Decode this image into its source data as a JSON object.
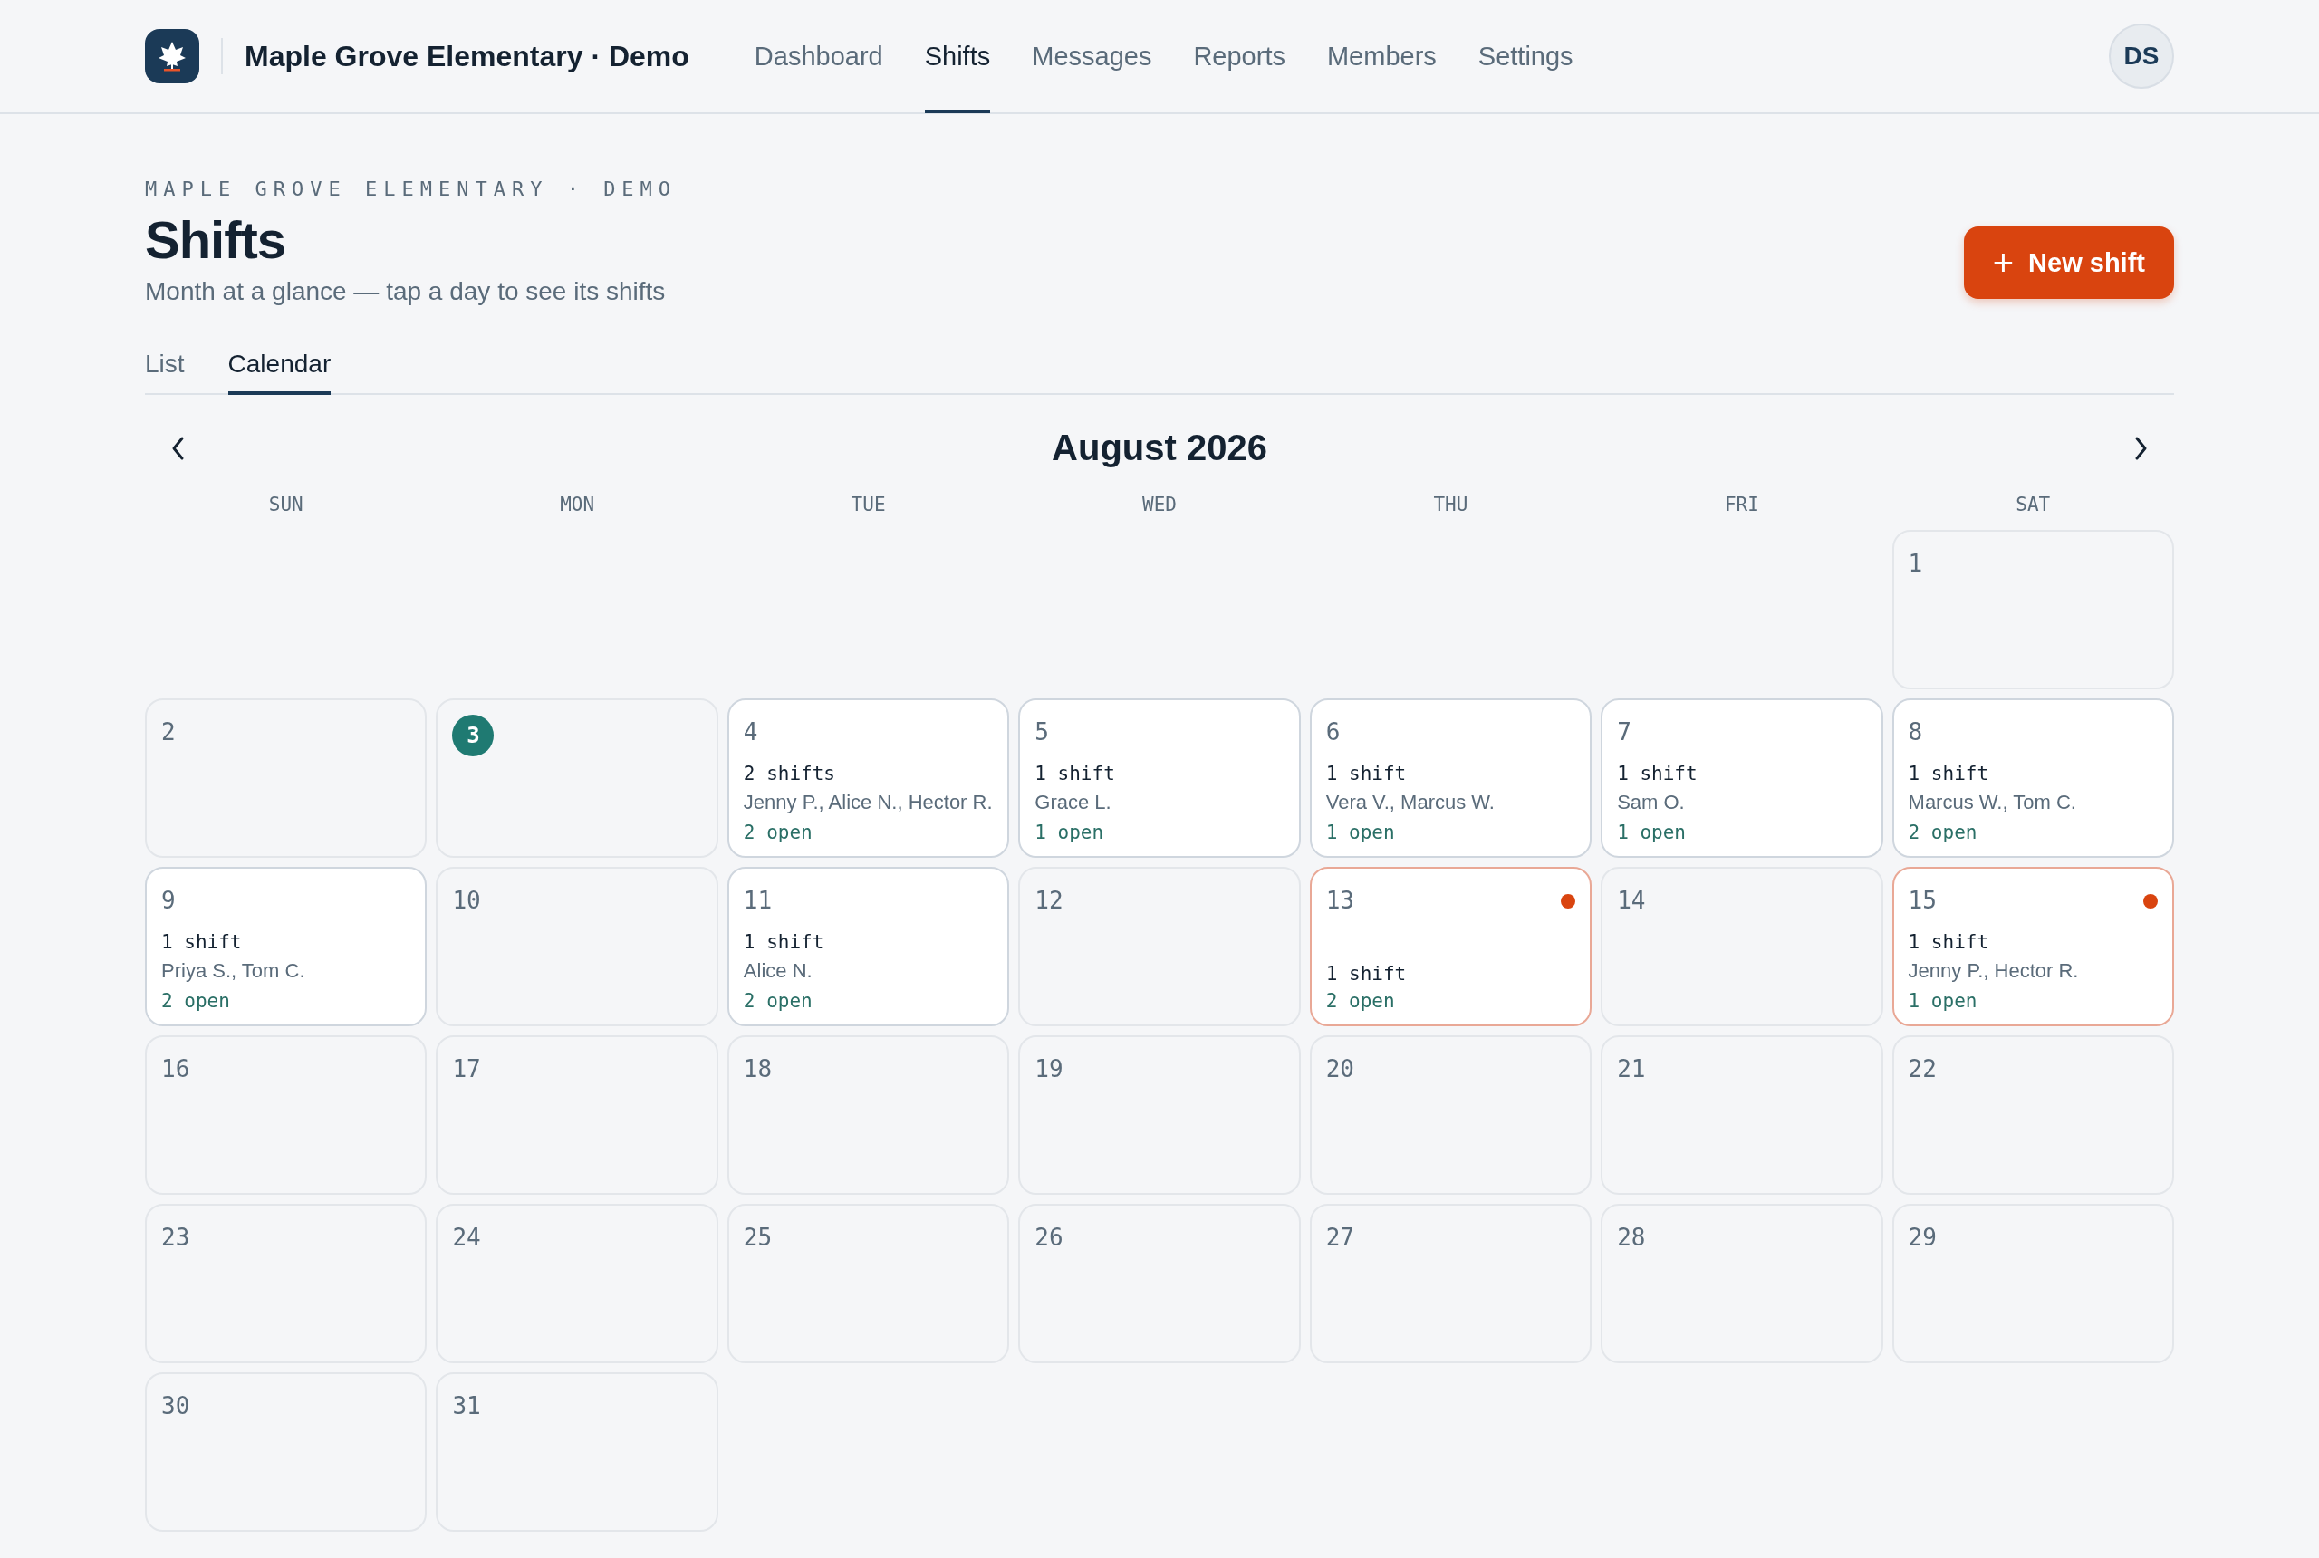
{
  "header": {
    "brand": "Maple Grove Elementary · Demo",
    "nav": [
      {
        "label": "Dashboard",
        "selected": false
      },
      {
        "label": "Shifts",
        "selected": true
      },
      {
        "label": "Messages",
        "selected": false
      },
      {
        "label": "Reports",
        "selected": false
      },
      {
        "label": "Members",
        "selected": false
      },
      {
        "label": "Settings",
        "selected": false
      }
    ],
    "avatar": "DS"
  },
  "page": {
    "eyebrow": "MAPLE GROVE ELEMENTARY · DEMO",
    "title": "Shifts",
    "subtitle": "Month at a glance — tap a day to see its shifts",
    "button": {
      "icon": "+",
      "label": "New shift"
    }
  },
  "tabs": [
    {
      "label": "List",
      "selected": false
    },
    {
      "label": "Calendar",
      "selected": true
    }
  ],
  "calendar": {
    "month": "August 2026",
    "weekdays": [
      "SUN",
      "MON",
      "TUE",
      "WED",
      "THU",
      "FRI",
      "SAT"
    ],
    "weeks": [
      {
        "days": [
          {
            "day": "1",
            "kind": "empty",
            "today": false,
            "alert": false
          }
        ]
      },
      {
        "days": [
          {
            "day": "2",
            "kind": "empty",
            "today": false,
            "alert": false
          },
          {
            "day": "3",
            "kind": "empty",
            "today": true,
            "alert": false
          },
          {
            "day": "4",
            "kind": "scheduled",
            "today": false,
            "alert": false,
            "shifts": "2 shifts",
            "people": "Jenny P., Alice N., Hector R.",
            "open": "2 open"
          },
          {
            "day": "5",
            "kind": "scheduled",
            "today": false,
            "alert": false,
            "shifts": "1 shift",
            "people": "Grace L.",
            "open": "1 open"
          },
          {
            "day": "6",
            "kind": "scheduled",
            "today": false,
            "alert": false,
            "shifts": "1 shift",
            "people": "Vera V., Marcus W.",
            "open": "1 open"
          },
          {
            "day": "7",
            "kind": "scheduled",
            "today": false,
            "alert": false,
            "shifts": "1 shift",
            "people": "Sam O.",
            "open": "1 open"
          },
          {
            "day": "8",
            "kind": "scheduled",
            "today": false,
            "alert": false,
            "shifts": "1 shift",
            "people": "Marcus W., Tom C.",
            "open": "2 open"
          }
        ]
      },
      {
        "days": [
          {
            "day": "9",
            "kind": "scheduled",
            "today": false,
            "alert": false,
            "shifts": "1 shift",
            "people": "Priya S., Tom C.",
            "open": "2 open"
          },
          {
            "day": "10",
            "kind": "empty",
            "today": false,
            "alert": false
          },
          {
            "day": "11",
            "kind": "scheduled",
            "today": false,
            "alert": false,
            "shifts": "1 shift",
            "people": "Alice N.",
            "open": "2 open"
          },
          {
            "day": "12",
            "kind": "empty",
            "today": false,
            "alert": false
          },
          {
            "day": "13",
            "kind": "scheduled",
            "today": false,
            "alert": true,
            "shifts": "1 shift",
            "open": "2 open"
          },
          {
            "day": "14",
            "kind": "empty",
            "today": false,
            "alert": false
          },
          {
            "day": "15",
            "kind": "scheduled",
            "today": false,
            "alert": true,
            "shifts": "1 shift",
            "people": "Jenny P., Hector R.",
            "open": "1 open"
          }
        ]
      },
      {
        "days": [
          {
            "day": "16",
            "kind": "empty",
            "today": false,
            "alert": false
          },
          {
            "day": "17",
            "kind": "empty",
            "today": false,
            "alert": false
          },
          {
            "day": "18",
            "kind": "empty",
            "today": false,
            "alert": false
          },
          {
            "day": "19",
            "kind": "empty",
            "today": false,
            "alert": false
          },
          {
            "day": "20",
            "kind": "empty",
            "today": false,
            "alert": false
          },
          {
            "day": "21",
            "kind": "empty",
            "today": false,
            "alert": false
          },
          {
            "day": "22",
            "kind": "empty",
            "today": false,
            "alert": false
          }
        ]
      },
      {
        "days": [
          {
            "day": "23",
            "kind": "empty",
            "today": false,
            "alert": false
          },
          {
            "day": "24",
            "kind": "empty",
            "today": false,
            "alert": false
          },
          {
            "day": "25",
            "kind": "empty",
            "today": false,
            "alert": false
          },
          {
            "day": "26",
            "kind": "empty",
            "today": false,
            "alert": false
          },
          {
            "day": "27",
            "kind": "empty",
            "today": false,
            "alert": false
          },
          {
            "day": "28",
            "kind": "empty",
            "today": false,
            "alert": false
          },
          {
            "day": "29",
            "kind": "empty",
            "today": false,
            "alert": false
          }
        ]
      },
      {
        "days": [
          {
            "day": "30",
            "kind": "empty",
            "today": false,
            "alert": false
          },
          {
            "day": "31",
            "kind": "empty",
            "today": false,
            "alert": false
          }
        ]
      }
    ]
  }
}
